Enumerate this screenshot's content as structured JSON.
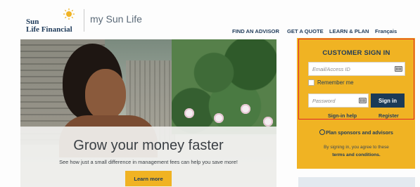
{
  "header": {
    "logo_line1": "Sun",
    "logo_line2": "Life Financial",
    "site_title": "my Sun Life"
  },
  "nav": {
    "items": [
      "FIND AN ADVISOR",
      "GET A QUOTE",
      "LEARN & PLAN",
      "Français"
    ]
  },
  "hero": {
    "headline": "Grow your money faster",
    "subtext": "See how just a small difference in management fees can help you save more!",
    "button_label": "Learn more"
  },
  "signin": {
    "title": "CUSTOMER SIGN IN",
    "email_placeholder": "Email/Access ID",
    "remember_label": "Remember me",
    "password_placeholder": "Password",
    "button_label": "Sign in",
    "help_link": "Sign-in help",
    "register_link": "Register"
  },
  "sidebar": {
    "sponsors_link": "Plan sponsors and advisors",
    "agree_text": "By signing in, you agree to these",
    "terms_link": "terms and conditions."
  },
  "colors": {
    "brand_yellow": "#f0b323",
    "brand_navy": "#1f3b5a",
    "highlight_red": "#e0262a"
  }
}
